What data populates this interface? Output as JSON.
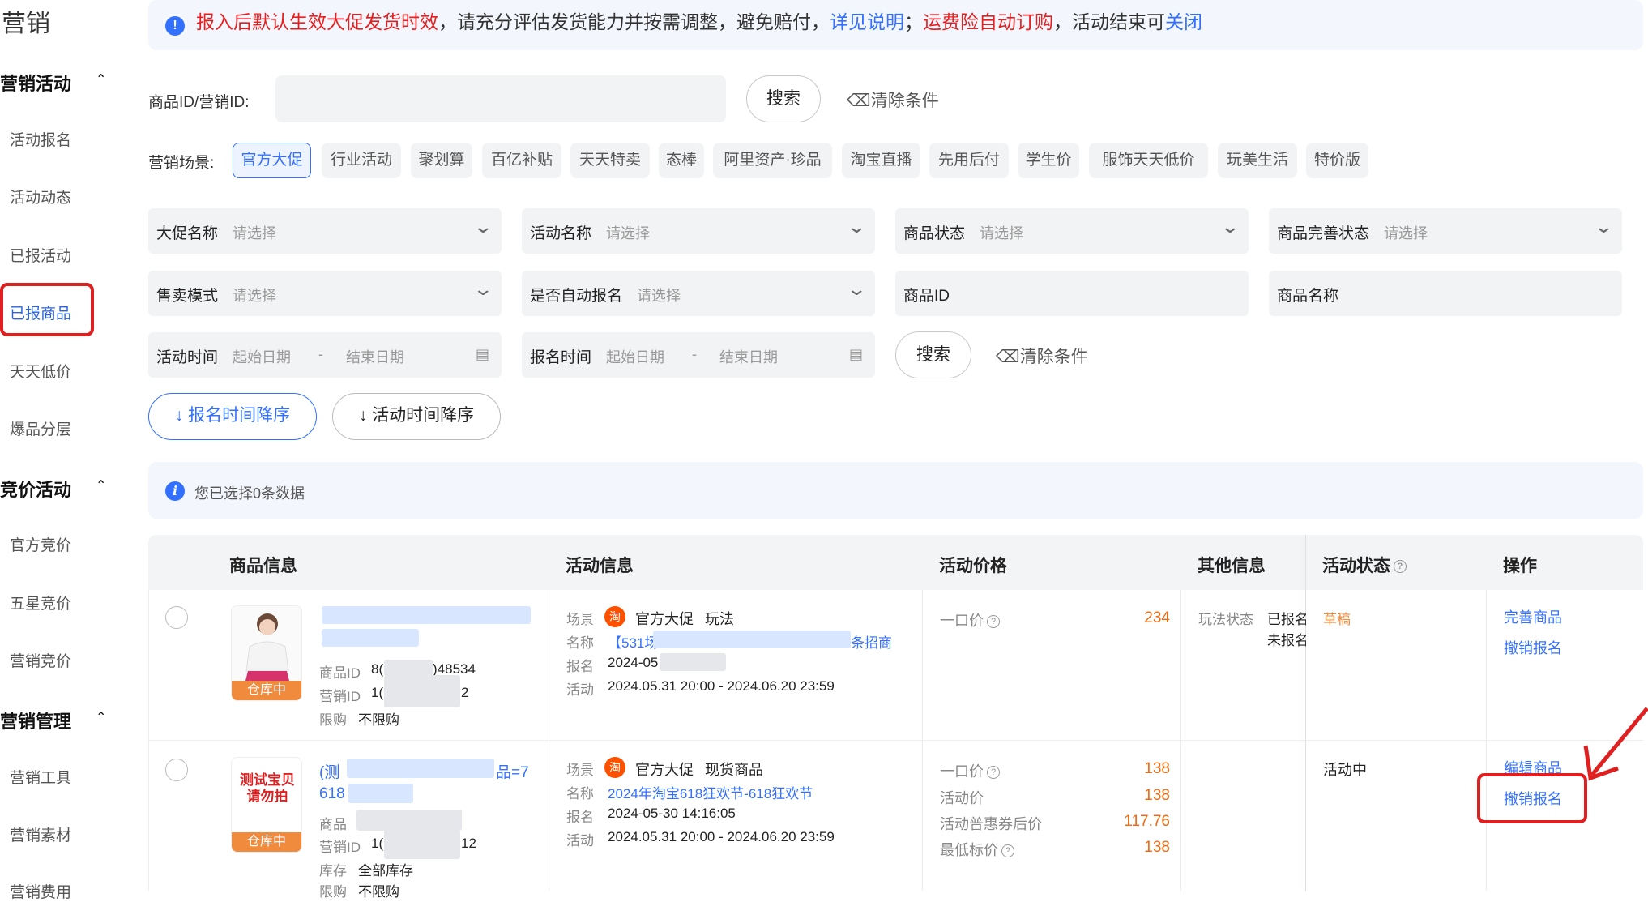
{
  "sidebar": {
    "title": "营销",
    "groups": [
      {
        "label": "营销活动",
        "items": [
          "活动报名",
          "活动动态",
          "已报活动",
          "已报商品",
          "天天低价",
          "爆品分层"
        ]
      },
      {
        "label": "竞价活动",
        "items": [
          "官方竞价",
          "五星竞价",
          "营销竞价"
        ]
      },
      {
        "label": "营销管理",
        "items": [
          "营销工具",
          "营销素材",
          "营销费用"
        ]
      }
    ],
    "active_item": "已报商品"
  },
  "notice": {
    "part1": "报入后默认生效大促发货时效",
    "part2": "，请充分评估发货能力并按需调整，避免赔付，",
    "link1": "详见说明",
    "sep": "；",
    "part3": "运费险自动订购",
    "part4": "，活动结束可",
    "link2": "关闭"
  },
  "search1": {
    "label": "商品ID/营销ID:",
    "button": "搜索",
    "clear": "清除条件"
  },
  "scene": {
    "label": "营销场景:",
    "chips": [
      "官方大促",
      "行业活动",
      "聚划算",
      "百亿补贴",
      "天天特卖",
      "态棒",
      "阿里资产·珍品",
      "淘宝直播",
      "先用后付",
      "学生价",
      "服饰天天低价",
      "玩美生活",
      "特价版"
    ],
    "active": "官方大促"
  },
  "filters": {
    "promo_name": {
      "label": "大促名称",
      "placeholder": "请选择"
    },
    "activity_name": {
      "label": "活动名称",
      "placeholder": "请选择"
    },
    "item_status": {
      "label": "商品状态",
      "placeholder": "请选择"
    },
    "item_complete": {
      "label": "商品完善状态",
      "placeholder": "请选择"
    },
    "sale_mode": {
      "label": "售卖模式",
      "placeholder": "请选择"
    },
    "auto_signup": {
      "label": "是否自动报名",
      "placeholder": "请选择"
    },
    "item_id": {
      "label": "商品ID"
    },
    "item_name": {
      "label": "商品名称"
    },
    "activity_time": {
      "label": "活动时间",
      "start": "起始日期",
      "dash": "-",
      "end": "结束日期"
    },
    "signup_time": {
      "label": "报名时间",
      "start": "起始日期",
      "dash": "-",
      "end": "结束日期"
    },
    "search": "搜索",
    "clear": "清除条件"
  },
  "sort": {
    "signup_desc": "报名时间降序",
    "activity_desc": "活动时间降序"
  },
  "selection": {
    "text": "您已选择0条数据"
  },
  "table": {
    "headers": [
      "商品信息",
      "活动信息",
      "活动价格",
      "其他信息",
      "活动状态",
      "操作"
    ],
    "rows": [
      {
        "stock": "仓库中",
        "item_id_label": "商品ID",
        "item_id_visible": "8(",
        "item_id_tail": ")48534",
        "marketing_id_label": "营销ID",
        "marketing_id_visible": "1(",
        "marketing_id_tail": "2",
        "limit_label": "限购",
        "limit_value": "不限购",
        "scene_label": "场景",
        "scene_value": "官方大促",
        "scene_type": "玩法",
        "name_label": "名称",
        "name_value_start": "【531场",
        "name_value_end": "条招商",
        "signup_label": "报名",
        "signup_value": "2024-05",
        "activity_label": "活动",
        "activity_value": "2024.05.31 20:00 - 2024.06.20 23:59",
        "prices": [
          {
            "label": "一口价",
            "value": "234"
          }
        ],
        "other_label": "玩法状态",
        "other_value1": "已报名",
        "other_value2": "未报名",
        "status": "草稿",
        "actions": [
          "完善商品",
          "撤销报名"
        ]
      },
      {
        "thumb_text": "测试宝贝请勿拍",
        "stock": "仓库中",
        "title_start": "(测",
        "title_end": "品=7",
        "title_line2": "618",
        "item_id_label": "商品",
        "marketing_id_label": "营销ID",
        "marketing_id_visible": "1(",
        "marketing_id_tail": "12",
        "stock_label": "库存",
        "stock_value": "全部库存",
        "limit_label": "限购",
        "limit_value": "不限购",
        "scene_label": "场景",
        "scene_value": "官方大促",
        "scene_type": "现货商品",
        "name_label": "名称",
        "name_value": "2024年淘宝618狂欢节-618狂欢节",
        "signup_label": "报名",
        "signup_value": "2024-05-30 14:16:05",
        "activity_label": "活动",
        "activity_value": "2024.05.31 20:00 - 2024.06.20 23:59",
        "prices": [
          {
            "label": "一口价",
            "value": "138"
          },
          {
            "label": "活动价",
            "value": "138"
          },
          {
            "label": "活动普惠券后价",
            "value": "117.76"
          },
          {
            "label": "最低标价",
            "value": "138"
          }
        ],
        "status": "活动中",
        "actions": [
          "编辑商品",
          "撤销报名"
        ]
      }
    ]
  },
  "taobao_glyph": "淘",
  "colors": {
    "accent": "#3370ff",
    "warning": "#e62020",
    "orange": "#f06a10",
    "annotation": "#e02020"
  }
}
